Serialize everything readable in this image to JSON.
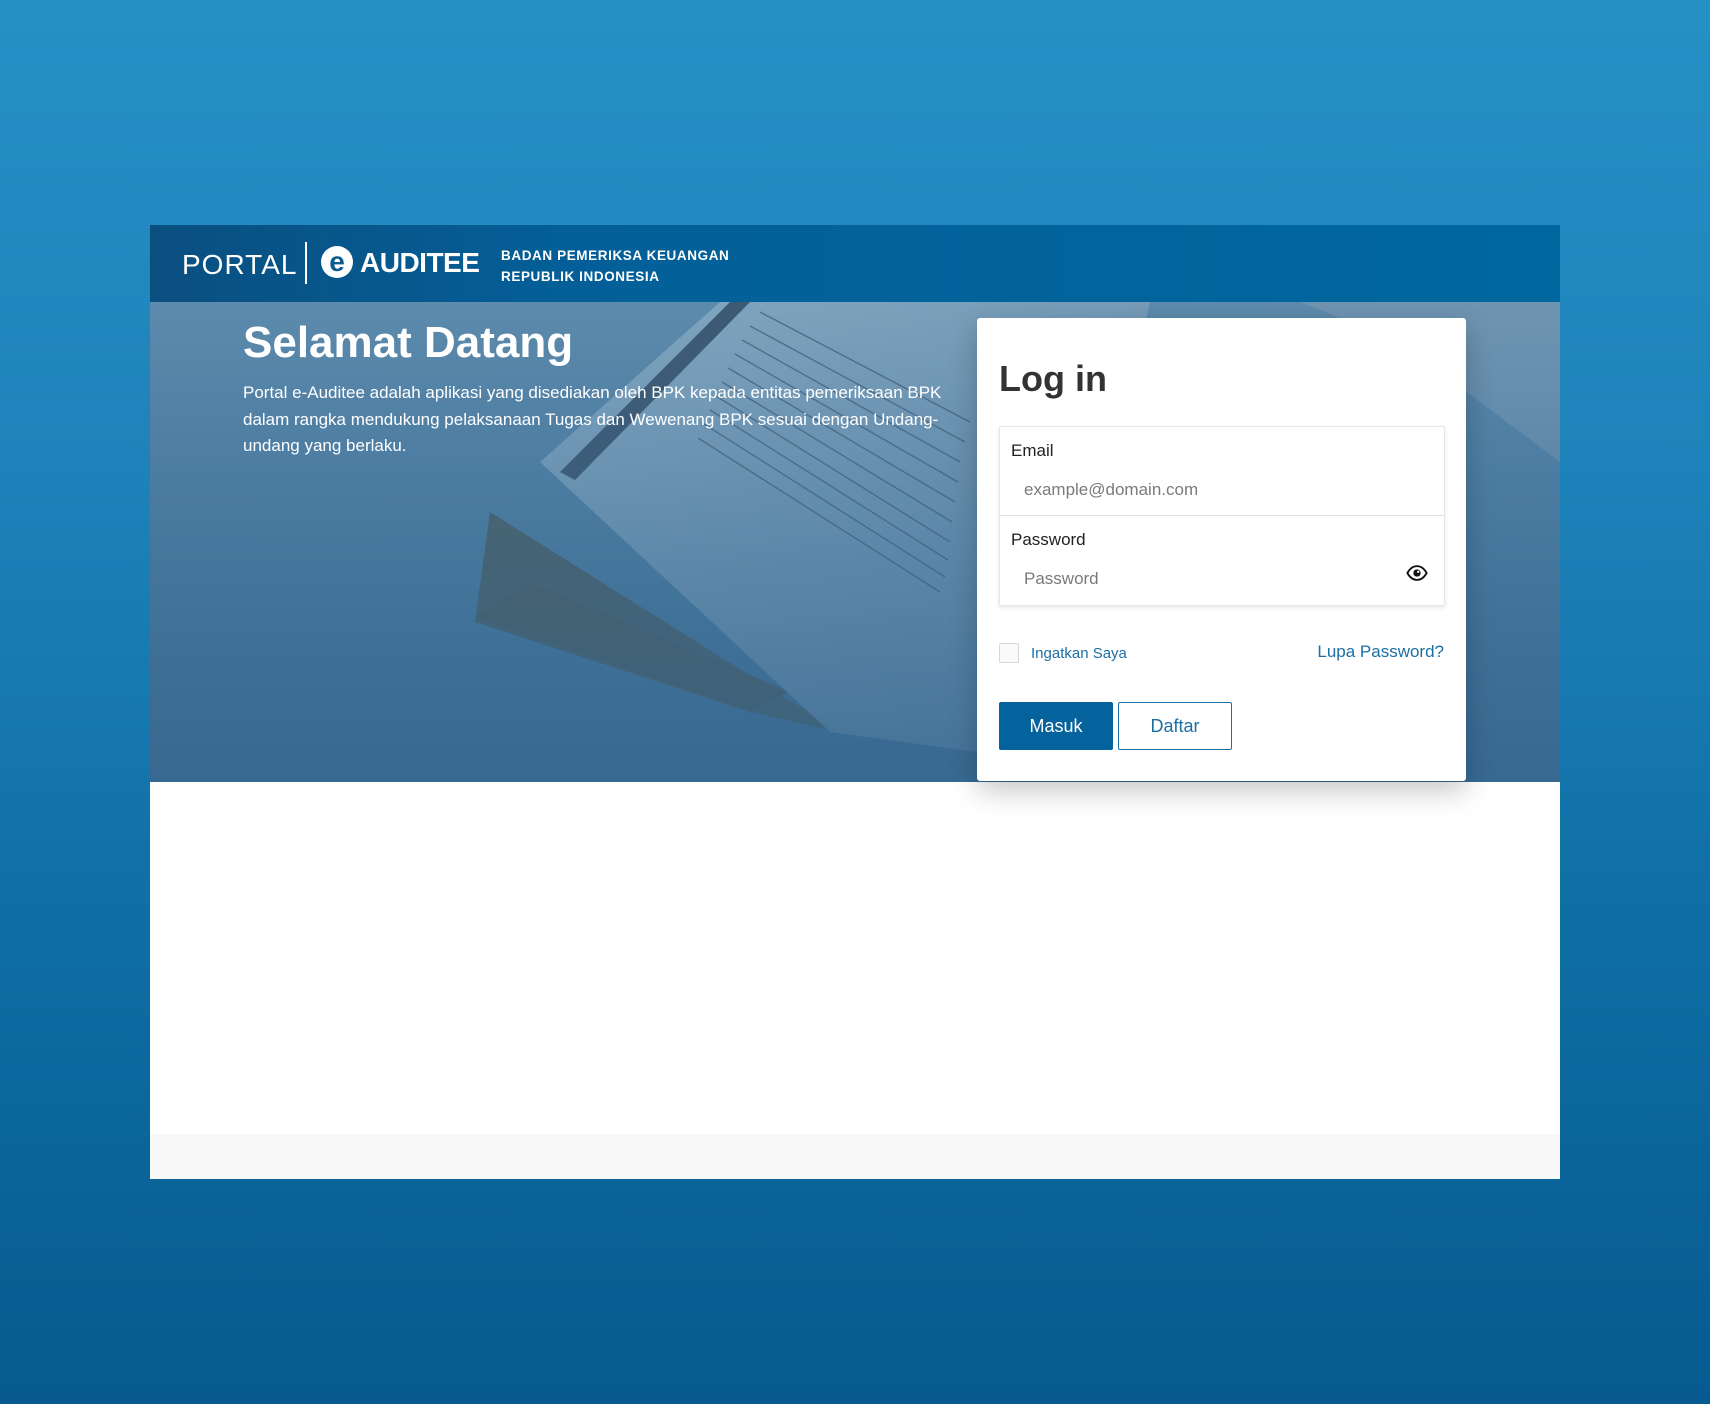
{
  "header": {
    "portal_label": "PORTAL",
    "e_label": "e",
    "product_label": "AUDITEE",
    "org_line1": "BADAN PEMERIKSA KEUANGAN",
    "org_line2": "REPUBLIK INDONESIA"
  },
  "hero": {
    "title": "Selamat Datang",
    "description": "Portal e-Auditee adalah aplikasi yang disediakan oleh BPK kepada entitas pemeriksaan BPK dalam rangka mendukung pelaksanaan Tugas dan Wewenang BPK sesuai dengan Undang-undang yang berlaku."
  },
  "login": {
    "title": "Log in",
    "email_label": "Email",
    "email_placeholder": "example@domain.com",
    "email_value": "",
    "password_label": "Password",
    "password_placeholder": "Password",
    "password_value": "",
    "password_toggle_icon": "eye-icon",
    "remember_label": "Ingatkan Saya",
    "remember_checked": false,
    "forgot_label": "Lupa Password?",
    "submit_label": "Masuk",
    "register_label": "Daftar"
  },
  "colors": {
    "primary": "#04629c",
    "link": "#1b6fa3",
    "header_bg": "#00689f"
  }
}
